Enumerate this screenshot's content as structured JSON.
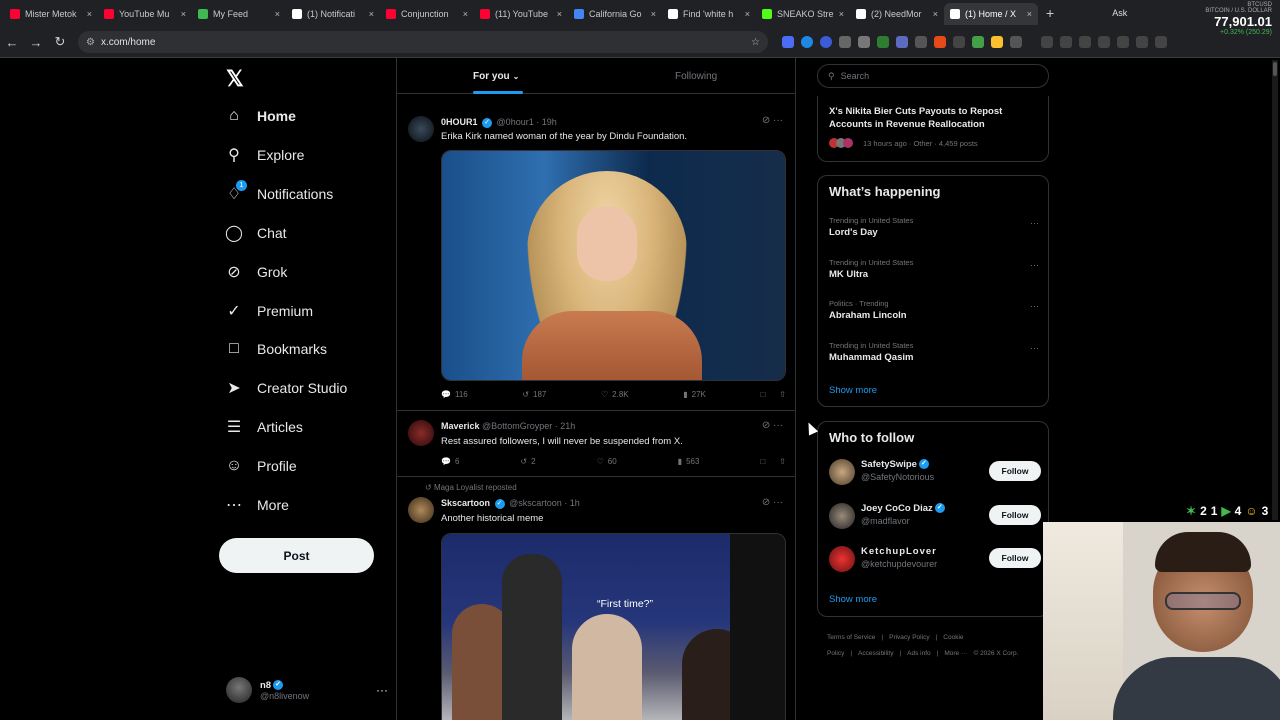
{
  "browser": {
    "tabs": [
      {
        "title": "Mister Metok",
        "color": "#ff0033"
      },
      {
        "title": "YouTube Mu",
        "color": "#ff0033"
      },
      {
        "title": "My Feed",
        "color": "#3fb950"
      },
      {
        "title": "(1) Notificati",
        "color": "#ffffff"
      },
      {
        "title": "Conjunction",
        "color": "#ff0033"
      },
      {
        "title": "(11) YouTube",
        "color": "#ff0033"
      },
      {
        "title": "California Go",
        "color": "#4285f4"
      },
      {
        "title": "Find 'white h",
        "color": "#ffffff"
      },
      {
        "title": "SNEAKO Stre",
        "color": "#53fc18"
      },
      {
        "title": "(2) NeedMor",
        "color": "#ffffff"
      },
      {
        "title": "(1) Home / X",
        "color": "#ffffff",
        "active": true
      }
    ],
    "new_tab": "+",
    "ask": "Ask",
    "url": "x.com/home",
    "ticker": {
      "label": "BTCUSD",
      "sub": "BITCOIN / U.S. DOLLAR",
      "price": "77,901.01",
      "change": "+0.32% (250.29)"
    }
  },
  "nav": {
    "items": [
      {
        "label": "Home",
        "icon": "home-icon",
        "active": true
      },
      {
        "label": "Explore",
        "icon": "search-icon"
      },
      {
        "label": "Notifications",
        "icon": "bell-icon",
        "badge": "1"
      },
      {
        "label": "Chat",
        "icon": "chat-icon"
      },
      {
        "label": "Grok",
        "icon": "grok-icon"
      },
      {
        "label": "Premium",
        "icon": "premium-icon"
      },
      {
        "label": "Bookmarks",
        "icon": "bookmark-icon"
      },
      {
        "label": "Creator Studio",
        "icon": "rocket-icon"
      },
      {
        "label": "Articles",
        "icon": "article-icon"
      },
      {
        "label": "Profile",
        "icon": "person-icon"
      },
      {
        "label": "More",
        "icon": "more-circle-icon"
      }
    ],
    "post_label": "Post",
    "account": {
      "name": "n8",
      "handle": "@n8livenow",
      "more": "···"
    }
  },
  "feed": {
    "tabs": {
      "for_you": "For you",
      "following": "Following"
    },
    "tweets": [
      {
        "name": "0HOUR1",
        "handle": "@0hour1",
        "time": "· 19h",
        "text": "Erika Kirk named woman of the year by Dindu Foundation.",
        "stats": {
          "replies": "116",
          "reposts": "187",
          "likes": "2.8K",
          "views": "27K"
        }
      },
      {
        "name": "Maverick",
        "handle": "@BottomGroyper",
        "time": "· 21h",
        "text": "Rest assured followers, I will never be suspended from X.",
        "stats": {
          "replies": "6",
          "reposts": "2",
          "likes": "60",
          "views": "563"
        }
      },
      {
        "repost_note": "Maga Loyalist reposted",
        "name": "Skscartoon",
        "handle": "@skscartoon",
        "time": "· 1h",
        "text": "Another historical meme",
        "meme_caption": "“First time?”"
      }
    ]
  },
  "sidebar": {
    "search_placeholder": "Search",
    "news": {
      "title": "X's Nikita Bier Cuts Payouts to Repost Accounts in Revenue Reallocation",
      "meta": "13 hours ago · Other · 4,459 posts"
    },
    "happening": {
      "heading": "What’s happening",
      "trends": [
        {
          "context": "Trending in United States",
          "title": "Lord's Day"
        },
        {
          "context": "Trending in United States",
          "title": "MK Ultra"
        },
        {
          "context": "Politics · Trending",
          "title": "Abraham Lincoln"
        },
        {
          "context": "Trending in United States",
          "title": "Muhammad Qasim"
        }
      ],
      "show_more": "Show more"
    },
    "who_to_follow": {
      "heading": "Who to follow",
      "accounts": [
        {
          "name": "SafetySwipe",
          "handle": "@SafetyNotorious",
          "verified": true
        },
        {
          "name": "Joey CoCo Diaz",
          "handle": "@madflavor",
          "verified": true
        },
        {
          "name": "KetchupLover",
          "handle": "@ketchupdevourer",
          "verified": false
        }
      ],
      "follow_label": "Follow",
      "show_more": "Show more"
    },
    "footer": [
      "Terms of Service",
      "|",
      "Privacy Policy",
      "|",
      "Cookie Policy",
      "|",
      "Accessibility",
      "|",
      "Ads info",
      "|",
      "More ···",
      "© 2026 X Corp."
    ]
  },
  "overlay": {
    "stats": [
      "2",
      "1",
      "4",
      "3"
    ]
  },
  "colors": {
    "accent": "#1d9bf0",
    "background": "#000000",
    "border": "#2f3336"
  }
}
